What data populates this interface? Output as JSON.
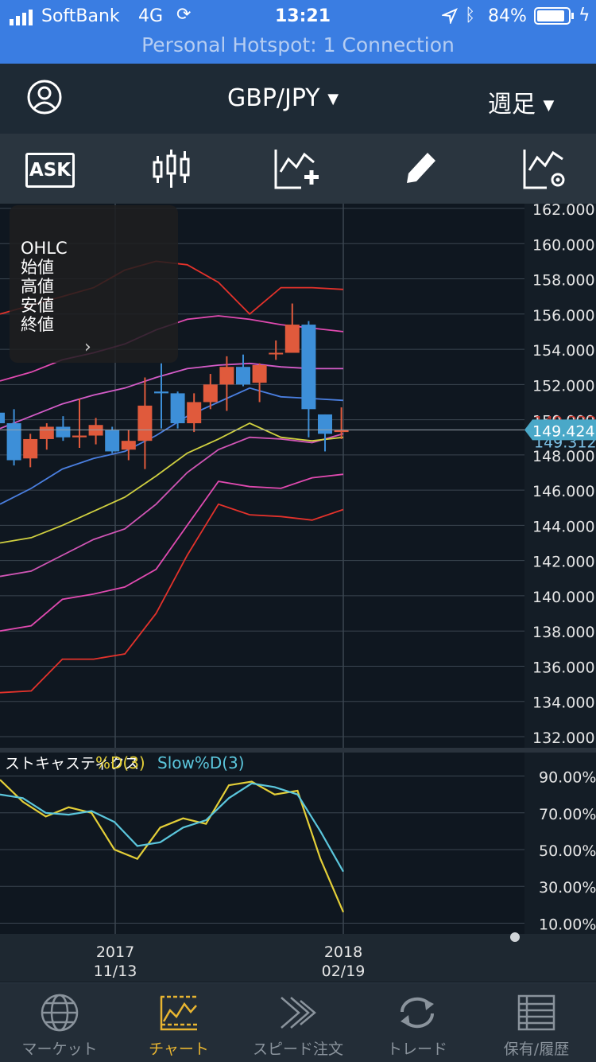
{
  "status_bar": {
    "carrier": "SoftBank",
    "network": "4G",
    "time": "13:21",
    "battery": "84%",
    "hotspot": "Personal Hotspot: 1 Connection"
  },
  "nav": {
    "symbol": "GBP/JPY",
    "timeframe": "週足"
  },
  "toolbar": {
    "ask_label": "ASK"
  },
  "ohlc_panel": {
    "title": "OHLC",
    "open": "始値",
    "high": "高値",
    "low": "安値",
    "close": "終値"
  },
  "indicator": {
    "name": "ストキャスティクス",
    "d_label": "%D(3)",
    "slow_label": "Slow%D(3)"
  },
  "price_axis": [
    "162.000",
    "160.000",
    "158.000",
    "156.000",
    "154.000",
    "152.000",
    "150.000",
    "148.000",
    "146.000",
    "144.000",
    "142.000",
    "140.000",
    "138.000",
    "136.000",
    "134.000",
    "132.000"
  ],
  "price_markers": {
    "current": "149.424",
    "upper_hidden": "149.333",
    "lower_hidden": "149.312"
  },
  "stoch_axis": [
    "90.00%",
    "70.00%",
    "50.00%",
    "30.00%",
    "10.00%"
  ],
  "date_axis": [
    {
      "year": "2017",
      "date": "11/13"
    },
    {
      "year": "2018",
      "date": "02/19"
    }
  ],
  "tabs": [
    {
      "label": "マーケット",
      "icon": "globe-icon"
    },
    {
      "label": "チャート",
      "icon": "chart-icon"
    },
    {
      "label": "スピード注文",
      "icon": "speed-order-icon"
    },
    {
      "label": "トレード",
      "icon": "trade-icon"
    },
    {
      "label": "保有/履歴",
      "icon": "positions-icon"
    }
  ],
  "colors": {
    "bull": "#e05a3c",
    "bear": "#3d8fd8",
    "accent": "#e8b531",
    "status_bar": "#3a7de2",
    "current_price": "#4aa8c8"
  },
  "chart_data": [
    {
      "type": "candlestick",
      "ylim": [
        132,
        162
      ],
      "candles": [
        {
          "o": 150.4,
          "h": 151.3,
          "l": 149.6,
          "c": 149.8
        },
        {
          "o": 149.8,
          "h": 150.6,
          "l": 147.4,
          "c": 147.7
        },
        {
          "o": 147.8,
          "h": 149.2,
          "l": 147.3,
          "c": 148.9
        },
        {
          "o": 148.9,
          "h": 149.8,
          "l": 148.3,
          "c": 149.6
        },
        {
          "o": 149.6,
          "h": 150.2,
          "l": 148.8,
          "c": 149.0
        },
        {
          "o": 149.0,
          "h": 151.2,
          "l": 148.4,
          "c": 149.1
        },
        {
          "o": 149.1,
          "h": 150.1,
          "l": 148.6,
          "c": 149.7
        },
        {
          "o": 149.4,
          "h": 149.6,
          "l": 148.1,
          "c": 148.2
        },
        {
          "o": 148.3,
          "h": 149.4,
          "l": 147.7,
          "c": 148.8
        },
        {
          "o": 148.8,
          "h": 152.4,
          "l": 147.2,
          "c": 150.8
        },
        {
          "o": 151.6,
          "h": 153.2,
          "l": 149.5,
          "c": 151.5
        },
        {
          "o": 151.5,
          "h": 151.6,
          "l": 149.5,
          "c": 149.8
        },
        {
          "o": 149.8,
          "h": 151.5,
          "l": 149.3,
          "c": 151.0
        },
        {
          "o": 151.0,
          "h": 152.6,
          "l": 150.6,
          "c": 152.0
        },
        {
          "o": 152.0,
          "h": 153.6,
          "l": 150.5,
          "c": 153.0
        },
        {
          "o": 153.0,
          "h": 153.7,
          "l": 151.9,
          "c": 152.0
        },
        {
          "o": 152.1,
          "h": 153.2,
          "l": 151.0,
          "c": 153.1
        },
        {
          "o": 153.8,
          "h": 154.5,
          "l": 153.4,
          "c": 153.8
        },
        {
          "o": 153.8,
          "h": 156.6,
          "l": 153.8,
          "c": 155.4
        },
        {
          "o": 155.4,
          "h": 155.6,
          "l": 149.0,
          "c": 150.6
        },
        {
          "o": 150.3,
          "h": 150.3,
          "l": 148.2,
          "c": 149.2
        },
        {
          "o": 149.3,
          "h": 150.7,
          "l": 148.9,
          "c": 149.4
        }
      ],
      "bands": {
        "upper3": [
          156.0,
          156.5,
          157.0,
          157.5,
          158.5,
          159.0,
          158.8,
          157.8,
          156.0,
          157.5,
          157.5,
          157.4
        ],
        "upper2": [
          152.2,
          152.7,
          153.4,
          153.8,
          154.3,
          155.1,
          155.7,
          155.9,
          155.7,
          155.4,
          155.2,
          155.0
        ],
        "upper1": [
          149.5,
          150.2,
          150.9,
          151.4,
          151.8,
          152.4,
          152.9,
          153.1,
          153.2,
          153.0,
          152.9,
          152.9
        ],
        "mid": [
          145.2,
          146.1,
          147.2,
          147.8,
          148.2,
          149.1,
          150.2,
          151.0,
          151.8,
          151.3,
          151.2,
          151.1
        ],
        "lower1": [
          143.0,
          143.3,
          144.0,
          144.8,
          145.6,
          146.8,
          148.1,
          148.9,
          149.8,
          149.0,
          148.8,
          149.0
        ],
        "lower2": [
          141.1,
          141.4,
          142.3,
          143.2,
          143.8,
          145.2,
          147.0,
          148.3,
          149.0,
          148.9,
          148.7,
          149.2
        ],
        "lower3": [
          138.0,
          138.3,
          139.8,
          140.1,
          140.5,
          141.5,
          144.0,
          146.5,
          146.2,
          146.1,
          146.7,
          146.9
        ],
        "lower4": [
          134.5,
          134.6,
          136.4,
          136.4,
          136.7,
          139.0,
          142.3,
          145.2,
          144.6,
          144.5,
          144.3,
          144.9
        ]
      }
    },
    {
      "type": "line",
      "title": "ストキャスティクス",
      "ylim": [
        5,
        95
      ],
      "series": [
        {
          "name": "%D(3)",
          "values": [
            88,
            76,
            68,
            73,
            70,
            50,
            45,
            62,
            67,
            64,
            85,
            87,
            80,
            82,
            45,
            16
          ]
        },
        {
          "name": "Slow%D(3)",
          "values": [
            80,
            78,
            70,
            69,
            71,
            65,
            52,
            54,
            62,
            66,
            78,
            86,
            84,
            80,
            60,
            38
          ]
        }
      ]
    }
  ]
}
